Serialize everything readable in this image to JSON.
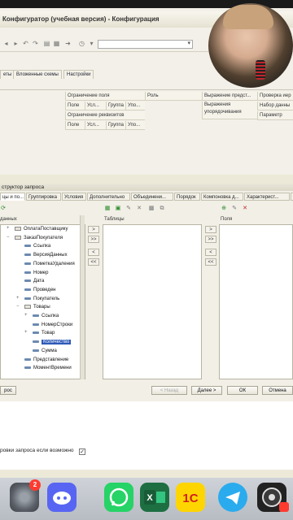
{
  "window": {
    "title": "Конфигуратор (учебная версия) - Конфигурация"
  },
  "tabs_main": [
    "еты",
    "Вложенные схемы",
    "Настройки"
  ],
  "grid": {
    "row1": [
      "Ограничение поля",
      "Роль",
      "Выражение предст...",
      "Проверка иер"
    ],
    "row2": [
      "Поле",
      "Усл...",
      "Группа",
      "Упо...",
      "Выражения упорядочивания",
      "Набор данны"
    ],
    "row3": [
      "Ограничение реквизитов"
    ],
    "row4": [
      "Поле",
      "Усл...",
      "Группа",
      "Упо...",
      "Параметр"
    ]
  },
  "dialog": {
    "title": "структор запроса",
    "tabs": [
      "цы и по...",
      "Группировка",
      "Условия",
      "Дополнительно",
      "Объединени...",
      "Порядок",
      "Компоновка д...",
      "Характерист...",
      "Па"
    ],
    "left_panel_title": "данных",
    "mid_panel_title": "Таблицы",
    "right_panel_title": "Поля",
    "tree": [
      {
        "label": "ОплатаПоставщику",
        "type": "table",
        "level": 0,
        "expander": "+"
      },
      {
        "label": "ЗаказПокупателя",
        "type": "table",
        "level": 0,
        "expander": "−"
      },
      {
        "label": "Ссылка",
        "type": "field",
        "level": 1,
        "expander": ""
      },
      {
        "label": "ВерсияДанных",
        "type": "field",
        "level": 1,
        "expander": ""
      },
      {
        "label": "ПометкаУдаления",
        "type": "field",
        "level": 1,
        "expander": ""
      },
      {
        "label": "Номер",
        "type": "field",
        "level": 1,
        "expander": ""
      },
      {
        "label": "Дата",
        "type": "field",
        "level": 1,
        "expander": ""
      },
      {
        "label": "Проведен",
        "type": "field",
        "level": 1,
        "expander": ""
      },
      {
        "label": "Покупатель",
        "type": "field",
        "level": 1,
        "expander": "+"
      },
      {
        "label": "Товары",
        "type": "table",
        "level": 1,
        "expander": "−"
      },
      {
        "label": "Ссылка",
        "type": "field",
        "level": 2,
        "expander": "+"
      },
      {
        "label": "НомерСтроки",
        "type": "field",
        "level": 2,
        "expander": ""
      },
      {
        "label": "Товар",
        "type": "field",
        "level": 2,
        "expander": "+"
      },
      {
        "label": "Количество",
        "type": "field",
        "level": 2,
        "expander": "",
        "selected": true
      },
      {
        "label": "Сумма",
        "type": "field",
        "level": 2,
        "expander": ""
      },
      {
        "label": "Представление",
        "type": "field",
        "level": 1,
        "expander": ""
      },
      {
        "label": "МоментВремени",
        "type": "field",
        "level": 1,
        "expander": ""
      }
    ],
    "move_buttons_1": [
      ">",
      ">>",
      "<",
      "<<"
    ],
    "move_buttons_2": [
      ">",
      ">>",
      "<",
      "<<"
    ],
    "footer": {
      "query_button": "рос",
      "back_button": "< Назад",
      "next_button": "Далее >",
      "ok_button": "ОК",
      "cancel_button": "Отмена"
    }
  },
  "option": {
    "label": "ровки запроса если возможно",
    "checked": "✓"
  },
  "dock": {
    "badge": "2",
    "apps": [
      "settings",
      "discord",
      "whatsapp",
      "excel",
      "1c",
      "telegram",
      "obs"
    ]
  },
  "colors": {
    "selection": "#2d59b8",
    "dialog_bg": "#f1efe6",
    "window_bg": "#f2f0e8"
  }
}
